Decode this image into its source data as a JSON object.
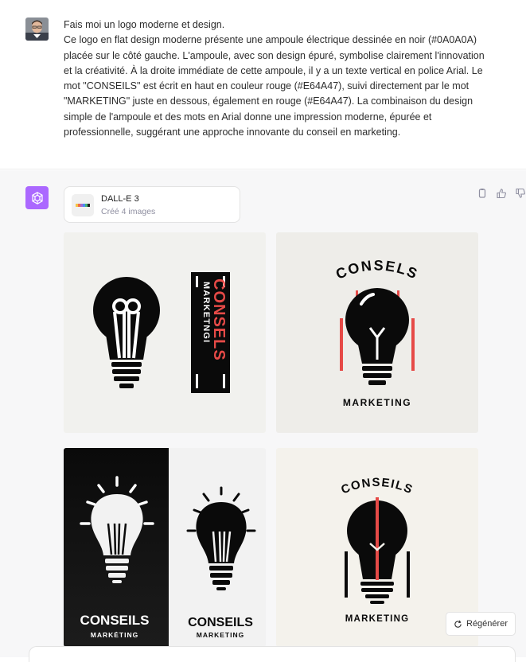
{
  "user_message": {
    "line1": "Fais moi un logo moderne et design.",
    "body": "Ce logo en flat design moderne présente une ampoule électrique dessinée en noir (#0A0A0A) placée sur le côté gauche. L'ampoule, avec son design épuré, symbolise clairement l'innovation et la créativité. À la droite immédiate de cette ampoule, il y a un texte vertical en police Arial. Le mot \"CONSEILS\" est écrit en haut en couleur rouge (#E64A47), suivi directement par le mot \"MARKETING\" juste en dessous, également en rouge (#E64A47). La combinaison du design simple de l'ampoule et des mots en Arial donne une impression moderne, épurée et professionnelle, suggérant une approche innovante du conseil en marketing."
  },
  "dalle": {
    "title": "DALL-E 3",
    "subtitle": "Créé 4 images"
  },
  "images": {
    "img1": {
      "conseils": "CONSELS",
      "marketing": "MARKETNGI"
    },
    "img2": {
      "conseils": "CONSELS",
      "marketing": "MARKETING"
    },
    "img3": {
      "conseils_left": "CONSEILS",
      "marketing_left": "MARKĖTING",
      "conseils_right": "CONSEILS",
      "marketing_right": "MARKETING"
    },
    "img4": {
      "conseils": "CONSEILS",
      "marketing": "MARKETING"
    }
  },
  "regenerate_label": "Régénérer",
  "colors": {
    "accent_red": "#E64A47",
    "bulb_black": "#0A0A0A",
    "gpt_purple": "#AB68FF"
  },
  "icons": [
    "user-avatar",
    "chatgpt-logo-icon",
    "copy-icon",
    "thumbs-up-icon",
    "thumbs-down-icon",
    "dalle-palette-icon",
    "refresh-icon"
  ]
}
